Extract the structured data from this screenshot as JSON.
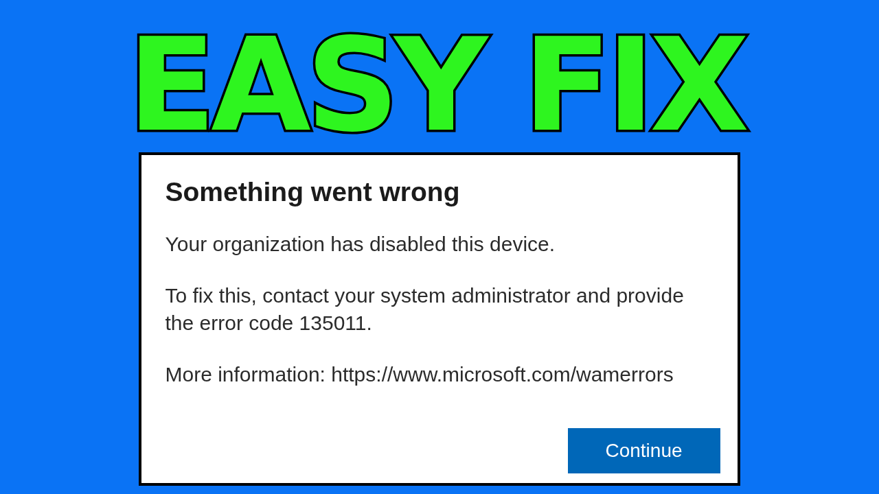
{
  "headline": "EASY FIX",
  "dialog": {
    "title": "Something went wrong",
    "paragraphs": [
      "Your organization has disabled this device.",
      "To fix this, contact your system administrator and provide the error code 135011.",
      "More information: https://www.microsoft.com/wamerrors"
    ],
    "button": "Continue"
  }
}
